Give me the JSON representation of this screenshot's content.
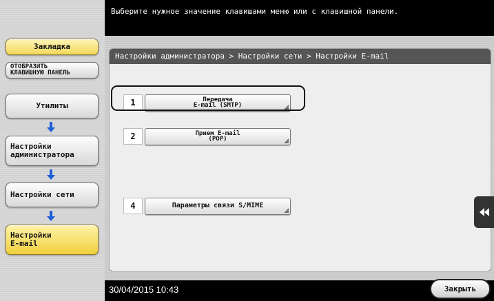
{
  "header": {
    "message": "Выберите нужное значение клавишами меню или с клавишной панели."
  },
  "sidebar": {
    "bookmark_label": "Закладка",
    "keypad_label": "ОТОБРАЗИТЬ\nКЛАВИШНУЮ ПАНЕЛЬ",
    "path": [
      {
        "label": "Утилиты"
      },
      {
        "label": "Настройки\nадминистратора"
      },
      {
        "label": "Настройки сети"
      },
      {
        "label": "Настройки\nE-mail"
      }
    ]
  },
  "breadcrumb": {
    "text": "Настройки администратора > Настройки сети > Настройки E-mail"
  },
  "options": [
    {
      "number": "1",
      "label": "Передача\nE-mail (SMTP)"
    },
    {
      "number": "2",
      "label": "Прием E-mail\n(POP)"
    },
    {
      "number": "4",
      "label": "Параметры связи S/MIME"
    }
  ],
  "footer": {
    "datetime": "30/04/2015  10:43",
    "close_label": "Закрыть"
  },
  "colors": {
    "accent_yellow": "#f3d85a",
    "arrow_blue": "#1f5fd6"
  }
}
